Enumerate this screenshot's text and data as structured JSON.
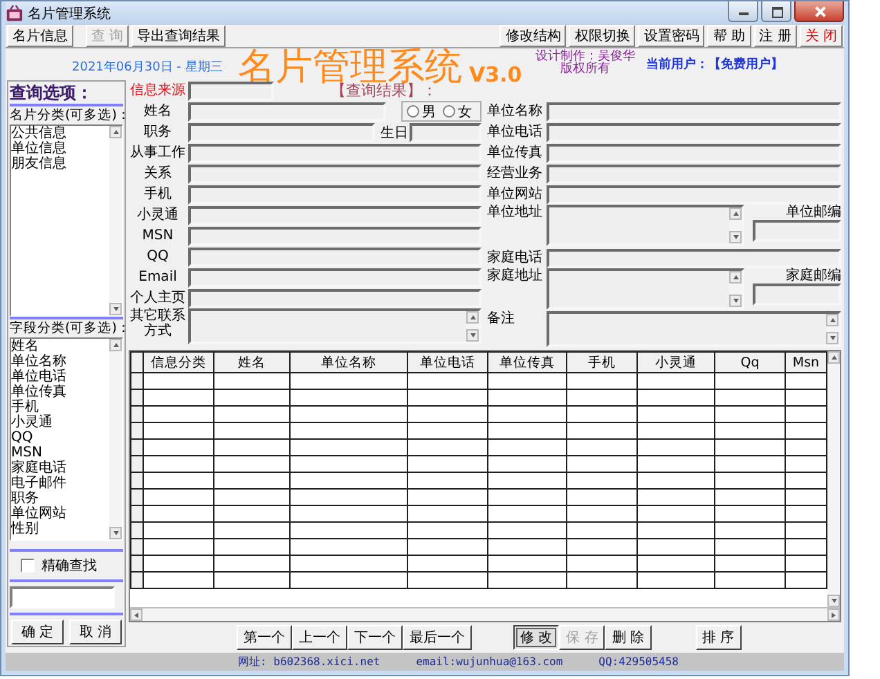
{
  "window": {
    "title": "名片管理系统"
  },
  "toolbar": {
    "left": [
      {
        "label": "名片信息",
        "disabled": false
      },
      {
        "label": "查 询",
        "disabled": true
      },
      {
        "label": "导出查询结果",
        "disabled": false
      }
    ],
    "right": [
      {
        "label": "修改结构",
        "disabled": false,
        "kind": "normal"
      },
      {
        "label": "权限切换",
        "disabled": false,
        "kind": "normal"
      },
      {
        "label": "设置密码",
        "disabled": false,
        "kind": "normal"
      },
      {
        "label": "帮 助",
        "disabled": false,
        "kind": "normal"
      },
      {
        "label": "注 册",
        "disabled": false,
        "kind": "normal"
      },
      {
        "label": "关 闭",
        "disabled": false,
        "kind": "danger"
      }
    ]
  },
  "header": {
    "date": "2021年06月30日 - 星期三",
    "title": "名片管理系统",
    "version": "V3.0",
    "designer": "设计制作：吴俊华",
    "copyright": "版权所有",
    "user_label": "当前用户：",
    "user": "【免费用户】"
  },
  "query_panel": {
    "title": "查询选项：",
    "card_categories": {
      "label": "名片分类(可多选)：",
      "items": [
        {
          "label": "公共信息",
          "selected": false
        },
        {
          "label": "单位信息",
          "selected": false
        },
        {
          "label": "朋友信息",
          "selected": false
        }
      ]
    },
    "field_categories": {
      "label": "字段分类(可多选)：",
      "items": [
        {
          "label": "姓名",
          "selected": false
        },
        {
          "label": "单位名称",
          "selected": false
        },
        {
          "label": "单位电话",
          "selected": false
        },
        {
          "label": "单位传真",
          "selected": false
        },
        {
          "label": "手机",
          "selected": false
        },
        {
          "label": "小灵通",
          "selected": false
        },
        {
          "label": "QQ",
          "selected": false
        },
        {
          "label": "MSN",
          "selected": false
        },
        {
          "label": "家庭电话",
          "selected": false
        },
        {
          "label": "电子邮件",
          "selected": false
        },
        {
          "label": "职务",
          "selected": false
        },
        {
          "label": "单位网站",
          "selected": false
        },
        {
          "label": "性别",
          "selected": false
        }
      ]
    },
    "exact_match": {
      "label": "精确查找",
      "checked": false
    },
    "buttons": [
      "确 定",
      "取 消"
    ]
  },
  "result_label": "【查询结果】：",
  "left_form": [
    {
      "label": "信息来源",
      "kind": "source",
      "color": "#e0101a"
    },
    {
      "label": "姓名",
      "kind": "name",
      "color": "#000000",
      "options": [
        {
          "label": "男",
          "selected": false
        },
        {
          "label": "女",
          "selected": false
        }
      ]
    },
    {
      "label": "职务",
      "kind": "title",
      "color": "#000000",
      "side_label": "生日"
    },
    {
      "label": "从事工作",
      "kind": "text",
      "color": "#000000"
    },
    {
      "label": "关系",
      "kind": "text",
      "color": "#000000"
    },
    {
      "label": "手机",
      "kind": "text",
      "color": "#000000"
    },
    {
      "label": "小灵通",
      "kind": "text",
      "color": "#000000"
    },
    {
      "label": "MSN",
      "kind": "text",
      "color": "#000000"
    },
    {
      "label": "QQ",
      "kind": "text",
      "color": "#000000"
    },
    {
      "label": "Email",
      "kind": "text",
      "color": "#000000"
    },
    {
      "label": "个人主页",
      "kind": "text",
      "color": "#000000"
    },
    {
      "label": "其它联系方式",
      "kind": "memo",
      "color": "#000000"
    }
  ],
  "right_form": [
    {
      "label": "单位名称",
      "kind": "text"
    },
    {
      "label": "单位电话",
      "kind": "text"
    },
    {
      "label": "单位传真",
      "kind": "text"
    },
    {
      "label": "经营业务",
      "kind": "text"
    },
    {
      "label": "单位网站",
      "kind": "text"
    },
    {
      "label": "单位地址",
      "kind": "address",
      "postcode_label": "单位邮编"
    },
    {
      "label": "家庭电话",
      "kind": "text"
    },
    {
      "label": "家庭地址",
      "kind": "address",
      "postcode_label": "家庭邮编"
    },
    {
      "label": "备注",
      "kind": "memo"
    }
  ],
  "table": {
    "columns": [
      "信息分类",
      "姓名",
      "单位名称",
      "单位电话",
      "单位传真",
      "手机",
      "小灵通",
      "Qq",
      "Msn"
    ]
  },
  "navigation": [
    "第一个",
    "上一个",
    "下一个",
    "最后一个"
  ],
  "record_buttons": [
    {
      "label": "修 改",
      "pressed": true,
      "disabled": false
    },
    {
      "label": "保 存",
      "pressed": false,
      "disabled": true
    },
    {
      "label": "删 除",
      "pressed": false,
      "disabled": false
    }
  ],
  "sort_button": "排 序",
  "status_bar": [
    "网址: b602368.xici.net",
    "email:wujunhua@163.com",
    "QQ:429505458"
  ]
}
